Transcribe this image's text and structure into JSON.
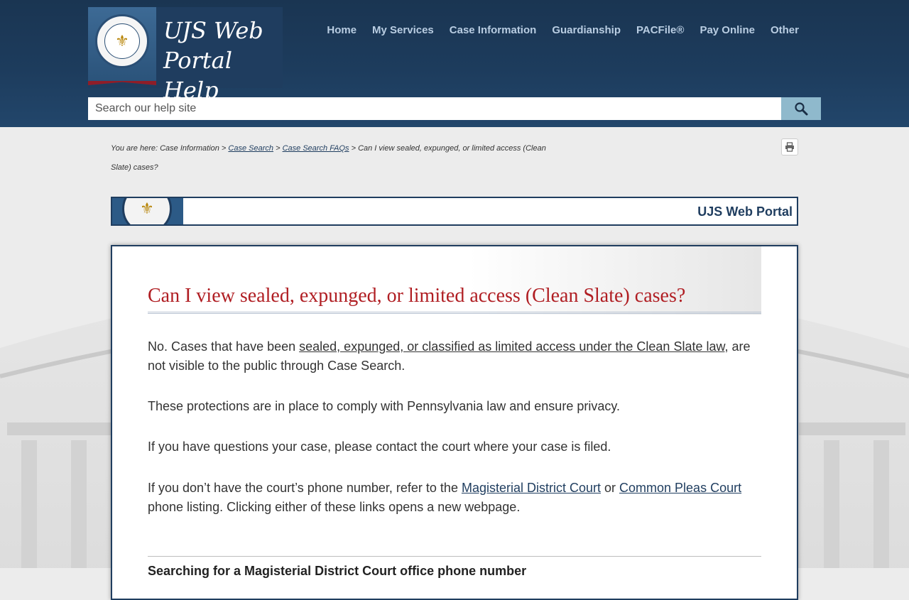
{
  "header": {
    "logo_line1": "UJS Web",
    "logo_line2": "Portal Help",
    "nav": [
      "Home",
      "My Services",
      "Case Information",
      "Guardianship",
      "PACFile®",
      "Pay Online",
      "Other"
    ],
    "search_placeholder": "Search our help site"
  },
  "breadcrumb": {
    "prefix": "You are here: Case Information >",
    "link1": "Case Search",
    "sep": ">",
    "link2": "Case Search FAQs",
    "current": "> Can I view sealed, expunged, or limited access (Clean Slate) cases?"
  },
  "portal_banner": {
    "title": "UJS Web Portal"
  },
  "article": {
    "title": "Can I view sealed, expunged, or limited access (Clean Slate) cases?",
    "p1_before": "No. Cases that have been ",
    "p1_link": "sealed, expunged, or classified as limited access under the Clean Slate law",
    "p1_after": ", are not visible to the public through Case Search.",
    "p2": "These protections are in place to comply with Pennsylvania law and ensure privacy.",
    "p3": "If you have questions your case, please contact the court where your case is filed.",
    "p4_before": "If you don’t have the court’s phone number, refer to the ",
    "p4_link1": "Magisterial District Court",
    "p4_mid": " or ",
    "p4_link2": "Common Pleas Court",
    "p4_after": " phone listing. Clicking either of these links opens a new webpage.",
    "section_heading": "Searching for a Magisterial District Court office phone number"
  },
  "icons": {
    "search": "magnifier-icon",
    "print": "printer-icon",
    "seal": "pa-supreme-court-seal"
  },
  "colors": {
    "header_bg": "#1d3c5d",
    "nav_text": "#b9cde2",
    "title_red": "#b01e23",
    "link_navy": "#1f3d5f",
    "search_button": "#8fb9cc"
  }
}
